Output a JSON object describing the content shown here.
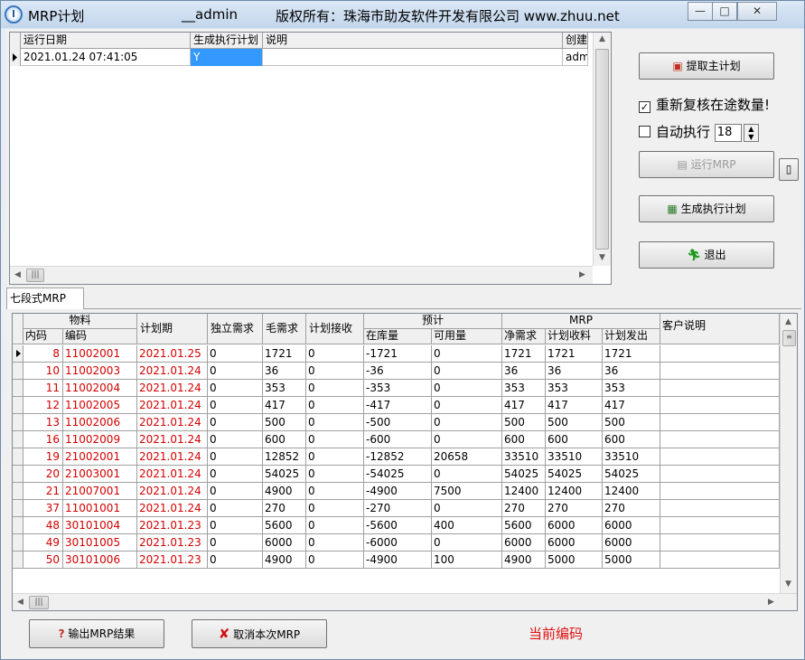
{
  "window": {
    "title": "MRP计划",
    "user": "__admin",
    "copyright": "版权所有：珠海市助友软件开发有限公司 www.zhuu.net",
    "minimize_label": "—",
    "maximize_label": "□",
    "close_label": "✕"
  },
  "top_grid": {
    "columns": [
      "运行日期",
      "生成执行计划",
      "说明",
      "创建人"
    ],
    "row": {
      "run_date": "2021.01.24 07:41:05",
      "generated": "Y",
      "note": "",
      "creator": "admi"
    }
  },
  "right_panel": {
    "fetch_master_plan": "提取主计划",
    "recheck_transit": "重新复核在途数量!",
    "recheck_checked": true,
    "auto_execute": "自动执行",
    "auto_execute_checked": false,
    "auto_value": "18",
    "run_mrp": "运行MRP",
    "generate_plan": "生成执行计划",
    "exit": "退出"
  },
  "tab": {
    "label": "七段式MRP"
  },
  "mrp_grid": {
    "group_headers": {
      "material": "物料",
      "forecast": "预计",
      "mrp": "MRP"
    },
    "headers": {
      "inner_code": "内码",
      "code": "编码",
      "plan_date": "计划期",
      "independent_demand": "独立需求",
      "gross_demand": "毛需求",
      "planned_receipt": "计划接收",
      "on_hand": "在库量",
      "available": "可用量",
      "net_demand": "净需求",
      "plan_receive": "计划收料",
      "plan_issue": "计划发出",
      "customer_note": "客户说明"
    },
    "rows": [
      {
        "inner": "8",
        "code": "11002001",
        "date": "2021.01.25",
        "ind": "0",
        "gross": "1721",
        "recv": "0",
        "onhand": "-1721",
        "avail": "0",
        "net": "1721",
        "prcv": "1721",
        "pissue": "1721"
      },
      {
        "inner": "10",
        "code": "11002003",
        "date": "2021.01.24",
        "ind": "0",
        "gross": "36",
        "recv": "0",
        "onhand": "-36",
        "avail": "0",
        "net": "36",
        "prcv": "36",
        "pissue": "36"
      },
      {
        "inner": "11",
        "code": "11002004",
        "date": "2021.01.24",
        "ind": "0",
        "gross": "353",
        "recv": "0",
        "onhand": "-353",
        "avail": "0",
        "net": "353",
        "prcv": "353",
        "pissue": "353"
      },
      {
        "inner": "12",
        "code": "11002005",
        "date": "2021.01.24",
        "ind": "0",
        "gross": "417",
        "recv": "0",
        "onhand": "-417",
        "avail": "0",
        "net": "417",
        "prcv": "417",
        "pissue": "417"
      },
      {
        "inner": "13",
        "code": "11002006",
        "date": "2021.01.24",
        "ind": "0",
        "gross": "500",
        "recv": "0",
        "onhand": "-500",
        "avail": "0",
        "net": "500",
        "prcv": "500",
        "pissue": "500"
      },
      {
        "inner": "16",
        "code": "11002009",
        "date": "2021.01.24",
        "ind": "0",
        "gross": "600",
        "recv": "0",
        "onhand": "-600",
        "avail": "0",
        "net": "600",
        "prcv": "600",
        "pissue": "600"
      },
      {
        "inner": "19",
        "code": "21002001",
        "date": "2021.01.24",
        "ind": "0",
        "gross": "12852",
        "recv": "0",
        "onhand": "-12852",
        "avail": "20658",
        "net": "33510",
        "prcv": "33510",
        "pissue": "33510"
      },
      {
        "inner": "20",
        "code": "21003001",
        "date": "2021.01.24",
        "ind": "0",
        "gross": "54025",
        "recv": "0",
        "onhand": "-54025",
        "avail": "0",
        "net": "54025",
        "prcv": "54025",
        "pissue": "54025"
      },
      {
        "inner": "21",
        "code": "21007001",
        "date": "2021.01.24",
        "ind": "0",
        "gross": "4900",
        "recv": "0",
        "onhand": "-4900",
        "avail": "7500",
        "net": "12400",
        "prcv": "12400",
        "pissue": "12400"
      },
      {
        "inner": "37",
        "code": "11001001",
        "date": "2021.01.24",
        "ind": "0",
        "gross": "270",
        "recv": "0",
        "onhand": "-270",
        "avail": "0",
        "net": "270",
        "prcv": "270",
        "pissue": "270"
      },
      {
        "inner": "48",
        "code": "30101004",
        "date": "2021.01.23",
        "ind": "0",
        "gross": "5600",
        "recv": "0",
        "onhand": "-5600",
        "avail": "400",
        "net": "5600",
        "prcv": "6000",
        "pissue": "6000"
      },
      {
        "inner": "49",
        "code": "30101005",
        "date": "2021.01.23",
        "ind": "0",
        "gross": "6000",
        "recv": "0",
        "onhand": "-6000",
        "avail": "0",
        "net": "6000",
        "prcv": "6000",
        "pissue": "6000"
      },
      {
        "inner": "50",
        "code": "30101006",
        "date": "2021.01.23",
        "ind": "0",
        "gross": "4900",
        "recv": "0",
        "onhand": "-4900",
        "avail": "100",
        "net": "4900",
        "prcv": "5000",
        "pissue": "5000"
      }
    ]
  },
  "bottom": {
    "export_label": "输出MRP结果",
    "cancel_label": "取消本次MRP",
    "current_code_label": "当前编码"
  },
  "colors": {
    "red_text": "#d40000",
    "status_red": "#e01010",
    "selection_blue": "#3399ff"
  }
}
